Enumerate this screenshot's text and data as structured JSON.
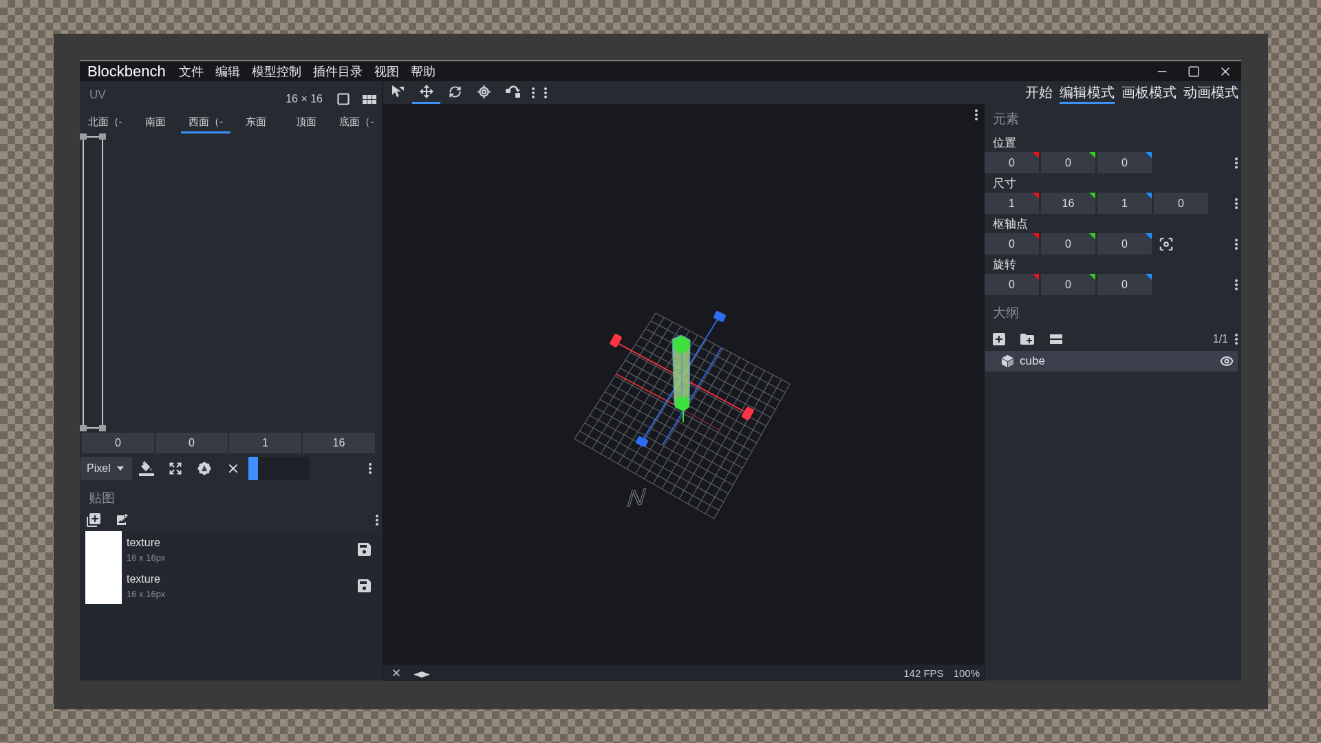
{
  "app": {
    "name": "Blockbench"
  },
  "menu": [
    "文件",
    "编辑",
    "模型控制",
    "插件目录",
    "视图",
    "帮助"
  ],
  "uv_panel": {
    "title": "UV",
    "size": "16 × 16",
    "faces": [
      {
        "label": "北面（-",
        "selected": false
      },
      {
        "label": "南面",
        "selected": false
      },
      {
        "label": "西面（-",
        "selected": true
      },
      {
        "label": "东面",
        "selected": false
      },
      {
        "label": "顶面",
        "selected": false
      },
      {
        "label": "底面（-",
        "selected": false
      }
    ],
    "uv_values": [
      "0",
      "0",
      "1",
      "16"
    ],
    "mode": "Pixel",
    "tint_slider": {
      "level": 0.16
    }
  },
  "textures_panel": {
    "title": "贴图",
    "textures": [
      {
        "name": "texture",
        "size": "16 x 16px"
      },
      {
        "name": "texture",
        "size": "16 x 16px"
      }
    ]
  },
  "tools": [
    {
      "kind": "cursor",
      "selected": false
    },
    {
      "kind": "move",
      "selected": true
    },
    {
      "kind": "rotate",
      "selected": false
    },
    {
      "kind": "pivot",
      "selected": false
    },
    {
      "kind": "snap",
      "selected": false
    }
  ],
  "modes": [
    {
      "label": "开始",
      "selected": false
    },
    {
      "label": "编辑模式",
      "selected": true
    },
    {
      "label": "画板模式",
      "selected": false
    },
    {
      "label": "动画模式",
      "selected": false
    }
  ],
  "element_panel": {
    "title": "元素",
    "groups": [
      {
        "label": "位置",
        "values": [
          {
            "value": "0",
            "color": "#f0101a"
          },
          {
            "value": "0",
            "color": "#30d020"
          },
          {
            "value": "0",
            "color": "#2090ff"
          }
        ]
      },
      {
        "label": "尺寸",
        "values": [
          {
            "value": "1",
            "color": "#f0101a"
          },
          {
            "value": "16",
            "color": "#30d020"
          },
          {
            "value": "1",
            "color": "#2090ff"
          },
          {
            "value": "0"
          }
        ]
      },
      {
        "label": "枢轴点",
        "focus_button": true,
        "values": [
          {
            "value": "0",
            "color": "#f0101a"
          },
          {
            "value": "0",
            "color": "#30d020"
          },
          {
            "value": "0",
            "color": "#2090ff"
          }
        ]
      },
      {
        "label": "旋转",
        "values": [
          {
            "value": "0",
            "color": "#f0101a"
          },
          {
            "value": "0",
            "color": "#30d020"
          },
          {
            "value": "0",
            "color": "#2090ff"
          }
        ]
      }
    ]
  },
  "outliner": {
    "title": "大纲",
    "count": "1/1",
    "items": [
      {
        "name": "cube",
        "selected": true,
        "visible": true
      }
    ]
  },
  "viewport": {
    "compass_label": "N"
  },
  "status_bar": {
    "fps": "142 FPS",
    "zoom": "100%"
  }
}
